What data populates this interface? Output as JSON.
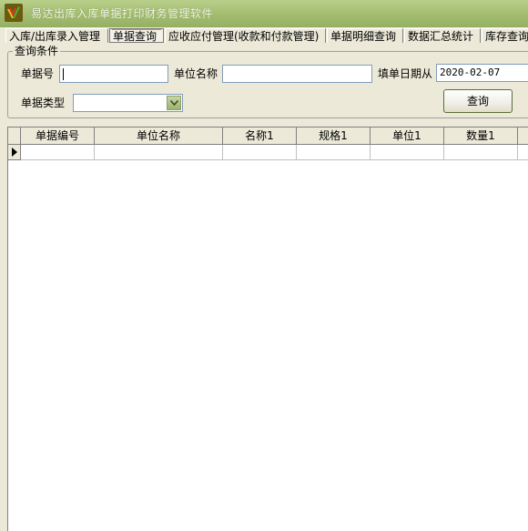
{
  "window": {
    "title": "易达出库入库单据打印财务管理软件",
    "app_icon": "app-logo-icon"
  },
  "tabs": [
    {
      "label": "入库/出库录入管理",
      "active": false
    },
    {
      "label": "单据查询",
      "active": true
    },
    {
      "label": "应收应付管理(收款和付款管理)",
      "active": false
    },
    {
      "label": "单据明细查询",
      "active": false
    },
    {
      "label": "数据汇总统计",
      "active": false
    },
    {
      "label": "库存查询",
      "active": false
    }
  ],
  "query": {
    "group_title": "查询条件",
    "doc_no_label": "单据号",
    "doc_no_value": "",
    "unit_name_label": "单位名称",
    "unit_name_value": "",
    "fill_date_label": "填单日期从",
    "fill_date_value": "2020-02-07",
    "doc_type_label": "单据类型",
    "doc_type_value": "",
    "query_button": "查询"
  },
  "grid": {
    "columns": [
      "单据编号",
      "单位名称",
      "名称1",
      "规格1",
      "单位1",
      "数量1"
    ],
    "rows": [
      [
        "",
        "",
        "",
        "",
        "",
        ""
      ]
    ],
    "current_row_icon": "row-pointer-icon"
  },
  "colors": {
    "titlebar": "#a5bf72",
    "window_bg": "#ece9d8",
    "active_tab_accent": "#e68b2c"
  }
}
